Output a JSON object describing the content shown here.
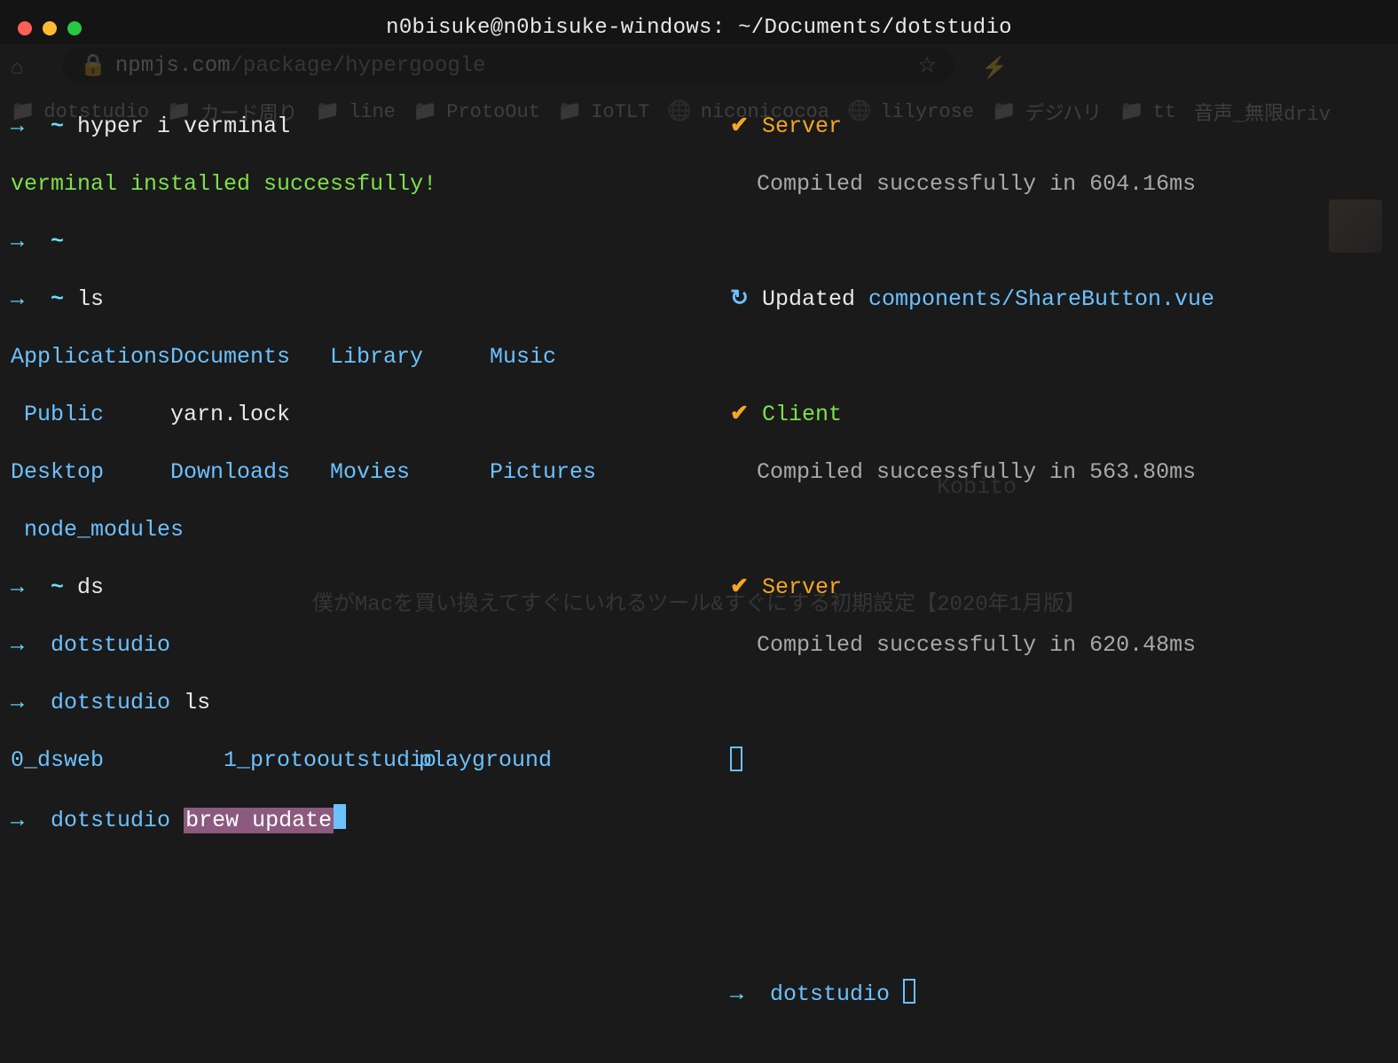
{
  "window": {
    "title": "n0bisuke@n0bisuke-windows: ~/Documents/dotstudio"
  },
  "background": {
    "url_host": "npmjs.com",
    "url_path": "/package/hypergoogle",
    "bookmarks": [
      "dotstudio",
      "カード周り",
      "line",
      "ProtoOut",
      "IoTLT",
      "niconicocoa",
      "lilyrose",
      "デジハリ",
      "tt",
      "音声_無限driv"
    ],
    "footer": "僕がMacを買い換えてすぐにいれるツール&すぐにする初期設定【2020年1月版】",
    "kobito": "Kobito"
  },
  "left": {
    "l1_prompt_home": "~",
    "l1_cmd": "hyper i verminal",
    "l2_msg": "verminal installed successfully!",
    "l3_home": "~",
    "l4_home": "~",
    "l4_cmd": "ls",
    "ls_row1_c1": "Applications",
    "ls_row1_c2": "Documents",
    "ls_row1_c3": "Library",
    "ls_row1_c4": "Music",
    "ls_row2_c1": " Public",
    "ls_row2_c2": "yarn.lock",
    "ls_row3_c1": "Desktop",
    "ls_row3_c2": "Downloads",
    "ls_row3_c3": "Movies",
    "ls_row3_c4": "Pictures",
    "ls_row4_c1": " node_modules",
    "l5_home": "~",
    "l5_cmd": "ds",
    "l6_dir": "dotstudio",
    "l7_dir": "dotstudio",
    "l7_cmd": "ls",
    "ls2_c1": "0_dsweb",
    "ls2_c2": "1_protooutstudio",
    "ls2_c3": "playground",
    "l8_dir": "dotstudio",
    "l8_cmd": "brew update"
  },
  "right": {
    "r1_label": "Server",
    "r1_msg": "Compiled successfully in 604.16ms",
    "r2_action": "Updated",
    "r2_file": "components/ShareButton.vue",
    "r3_label": "Client",
    "r3_msg": "Compiled successfully in 563.80ms",
    "r4_label": "Server",
    "r4_msg": "Compiled successfully in 620.48ms",
    "r5_dir": "dotstudio"
  }
}
